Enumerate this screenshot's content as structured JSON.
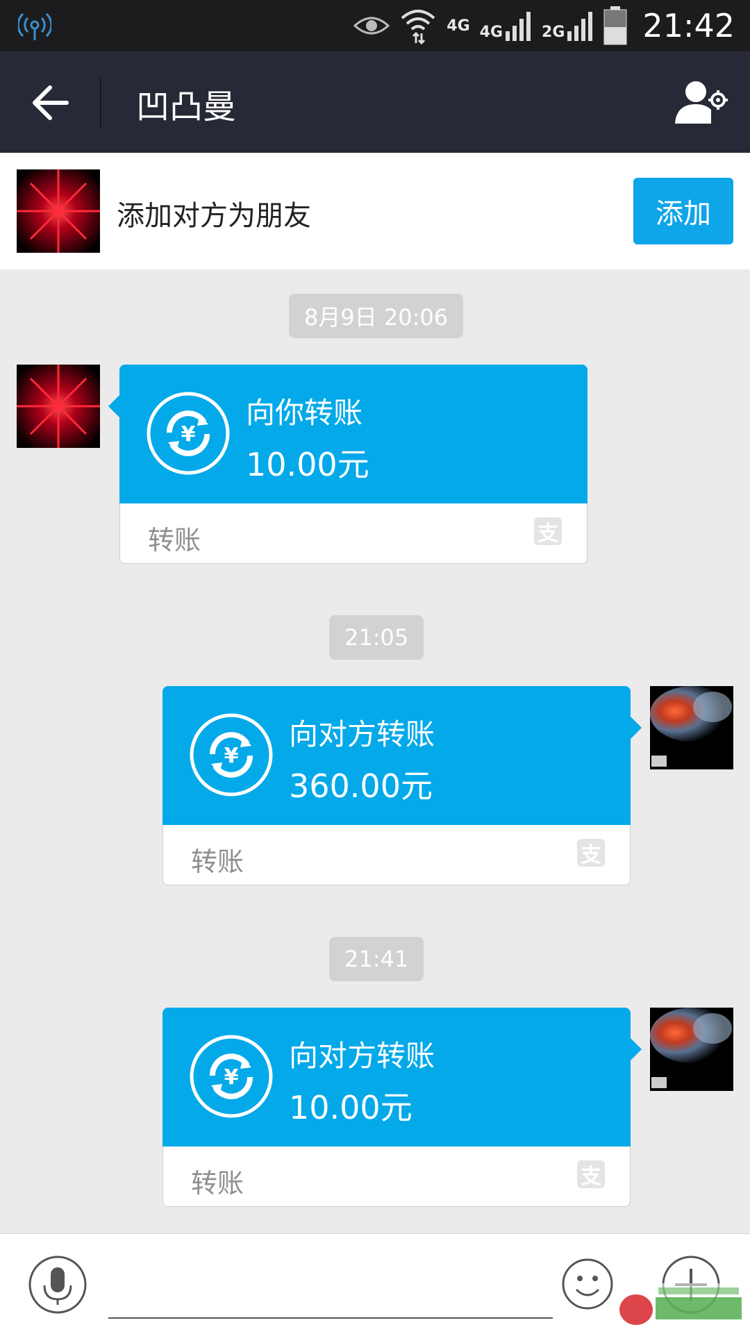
{
  "status_bar": {
    "network_1": "4G",
    "network_2": "4G",
    "network_3": "2G",
    "time": "21:42"
  },
  "header": {
    "title": "凹凸曼"
  },
  "add_friend": {
    "prompt": "添加对方为朋友",
    "button_label": "添加"
  },
  "messages": [
    {
      "timestamp": "8月9日 20:06",
      "direction": "incoming",
      "title": "向你转账",
      "amount": "10.00元",
      "footer": "转账",
      "footer_icon": "支"
    },
    {
      "timestamp": "21:05",
      "direction": "outgoing",
      "title": "向对方转账",
      "amount": "360.00元",
      "footer": "转账",
      "footer_icon": "支"
    },
    {
      "timestamp": "21:41",
      "direction": "outgoing",
      "title": "向对方转账",
      "amount": "10.00元",
      "footer": "转账",
      "footer_icon": "支"
    }
  ],
  "colors": {
    "title_bar": "#272a36",
    "accent": "#04a9e9",
    "background": "#ebebeb"
  }
}
